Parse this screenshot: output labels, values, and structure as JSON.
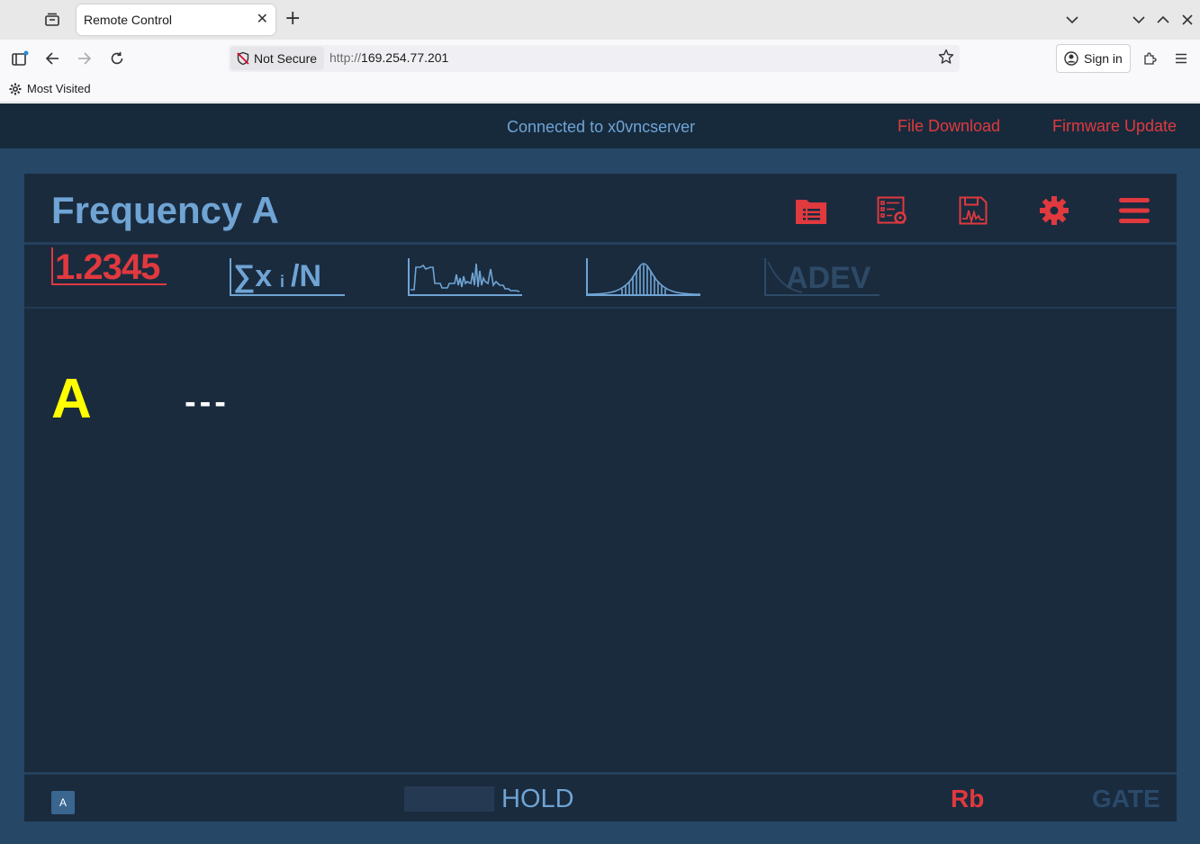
{
  "browser": {
    "tab_title": "Remote Control",
    "tab_close": "✕",
    "new_tab": "+",
    "not_secure_label": "Not Secure",
    "url_scheme": "http://",
    "url_host": "169.254.77.201",
    "sign_in_label": "Sign in",
    "bookmark_most_visited": "Most Visited"
  },
  "page": {
    "connection_status": "Connected to x0vncserver",
    "links": {
      "file_download": "File Download",
      "firmware_update": "Firmware Update"
    }
  },
  "instrument": {
    "title": "Frequency A",
    "header_icons": [
      "file-list-icon",
      "settings-list-icon",
      "save-graph-icon",
      "gear-icon",
      "hamburger-menu-icon"
    ],
    "modes": {
      "numeric": "1.2345",
      "statistics": "∑x",
      "statistics_sub": "i",
      "statistics_div": "/N",
      "timeline": "timeline-graph-icon",
      "histogram": "histogram-icon",
      "adev": "ADEV"
    },
    "channel": "A",
    "reading": "---",
    "status": {
      "channel_badge": "A",
      "hold": "HOLD",
      "reference": "Rb",
      "gate": "GATE"
    }
  },
  "colors": {
    "accent_red": "#e0393e",
    "accent_blue": "#6fa4d4",
    "channel_yellow": "#ffff00",
    "panel_bg": "#1a2b3e",
    "page_bg": "#264766"
  }
}
